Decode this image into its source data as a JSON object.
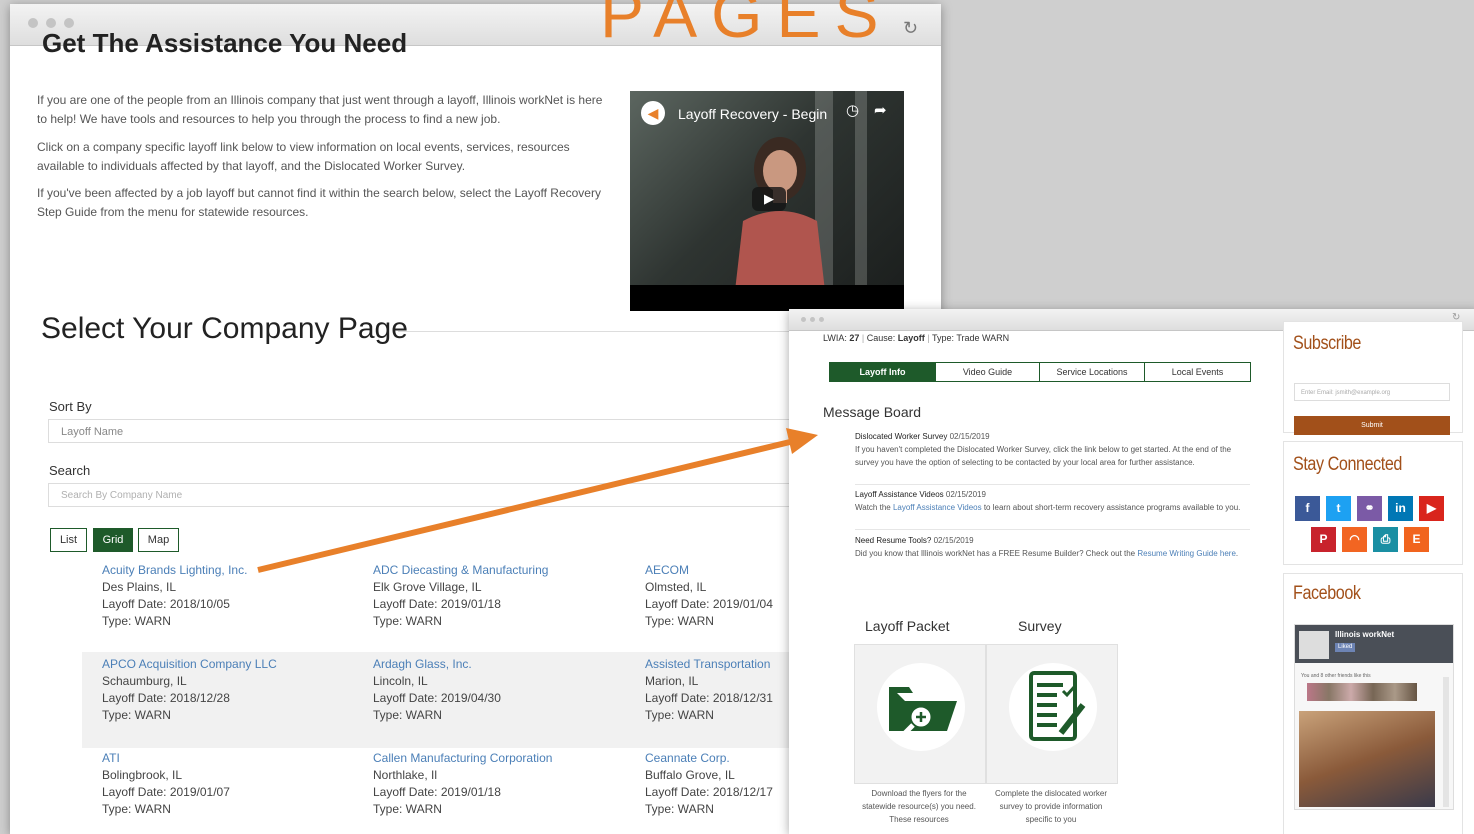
{
  "banner": {
    "text": "PAGES"
  },
  "win1": {
    "heading": "Get The Assistance You Need",
    "intro": [
      "If you are one of the people from an Illinois company that just went through a layoff, Illinois workNet is here to help! We have tools and resources to help you through the process to find a new job.",
      "Click on a company specific layoff link below to view information on local events, services, resources available to individuals affected by that layoff, and the Dislocated Worker Survey.",
      "If you've been affected by a job layoff but cannot find it within the search below, select the Layoff Recovery Step Guide from the menu for statewide resources."
    ],
    "video": {
      "title": "Layoff Recovery - Begin"
    },
    "select_title": "Select Your Company Page",
    "sort": {
      "label": "Sort By",
      "value": "Layoff Name"
    },
    "search": {
      "label": "Search",
      "placeholder": "Search By Company Name"
    },
    "views": [
      "List",
      "Grid",
      "Map"
    ],
    "active_view": "Grid",
    "companies": [
      {
        "name": "Acuity Brands Lighting, Inc.",
        "city": "Des Plains, IL",
        "date": "Layoff Date: 2018/10/05",
        "type": "Type: WARN"
      },
      {
        "name": "ADC Diecasting & Manufacturing",
        "city": "Elk Grove Village, IL",
        "date": "Layoff Date: 2019/01/18",
        "type": "Type: WARN"
      },
      {
        "name": "AECOM",
        "city": "Olmsted, IL",
        "date": "Layoff Date: 2019/01/04",
        "type": "Type: WARN"
      },
      {
        "name": "APCO Acquisition Company LLC",
        "city": "Schaumburg, IL",
        "date": "Layoff Date: 2018/12/28",
        "type": "Type: WARN"
      },
      {
        "name": "Ardagh Glass, Inc.",
        "city": "Lincoln, IL",
        "date": "Layoff Date: 2019/04/30",
        "type": "Type: WARN"
      },
      {
        "name": "Assisted Transportation",
        "city": "Marion, IL",
        "date": "Layoff Date: 2018/12/31",
        "type": "Type: WARN"
      },
      {
        "name": "ATI",
        "city": "Bolingbrook, IL",
        "date": "Layoff Date: 2019/01/07",
        "type": "Type: WARN"
      },
      {
        "name": "Callen Manufacturing Corporation",
        "city": "Northlake, Il",
        "date": "Layoff Date: 2019/01/18",
        "type": "Type: WARN"
      },
      {
        "name": "Ceannate Corp.",
        "city": "Buffalo Grove, IL",
        "date": "Layoff Date: 2018/12/17",
        "type": "Type: WARN"
      }
    ]
  },
  "win2": {
    "meta": {
      "lwia_label": "LWIA:",
      "lwia_value": "27",
      "cause_label": "Cause:",
      "cause_value": "Layoff",
      "type_label": "Type:",
      "type_value": "Trade WARN"
    },
    "tabs": [
      "Layoff Info",
      "Video Guide",
      "Service Locations",
      "Local Events"
    ],
    "message_board": {
      "title": "Message Board",
      "items": [
        {
          "title": "Dislocated Worker Survey",
          "date": "02/15/2019",
          "body": "If you haven't completed the Dislocated Worker Survey, click the link below to get started. At the end of the survey you have the option of selecting to be contacted by your local area for further assistance."
        },
        {
          "title": "Layoff Assistance Videos",
          "date": "02/15/2019",
          "body_pre": "Watch the ",
          "link": "Layoff Assistance Videos",
          "body_post": " to learn about short-term recovery assistance programs available to you."
        },
        {
          "title": "Need Resume Tools?",
          "date": "02/15/2019",
          "body_pre": "Did you know that Illinois workNet has a FREE Resume Builder? Check out the ",
          "link": "Resume Writing Guide here",
          "body_post": "."
        }
      ]
    },
    "packet": {
      "label": "Layoff Packet",
      "desc": "Download the flyers for the statewide resource(s) you need. These resources"
    },
    "survey": {
      "label": "Survey",
      "desc": "Complete the dislocated worker survey to provide information specific to you"
    },
    "subscribe": {
      "title": "Subscribe",
      "placeholder": "Enter Email: jsmith@example.org",
      "button": "Submit"
    },
    "stay_connected": {
      "title": "Stay Connected"
    },
    "facebook": {
      "title": "Facebook",
      "page_name": "Illinois workNet",
      "like": "Liked",
      "friends": "You and 8 other friends like this"
    }
  },
  "colors": {
    "accent_orange": "#e8802a",
    "dark_green": "#1e5a2a",
    "brown": "#a2501a",
    "link_blue": "#4b7fb7"
  },
  "social_icons": [
    "facebook-icon",
    "twitter-icon",
    "handshake-icon",
    "linkedin-icon",
    "youtube-icon",
    "pinterest-icon",
    "rss-icon",
    "print-icon",
    "etsy-icon"
  ]
}
